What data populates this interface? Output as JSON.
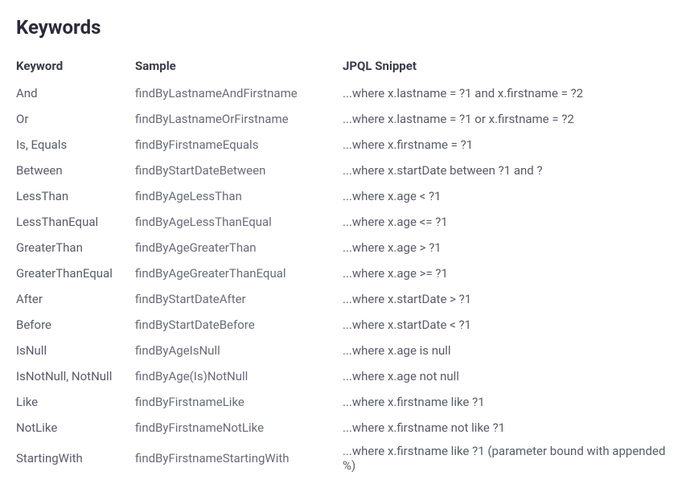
{
  "title": "Keywords",
  "headers": {
    "keyword": "Keyword",
    "sample": "Sample",
    "jpql": "JPQL Snippet"
  },
  "rows": [
    {
      "keyword": "And",
      "sample": "findByLastnameAndFirstname",
      "jpql": "...where x.lastname = ?1 and x.firstname = ?2"
    },
    {
      "keyword": "Or",
      "sample": "findByLastnameOrFirstname",
      "jpql": "...where x.lastname = ?1 or x.firstname = ?2"
    },
    {
      "keyword": "Is, Equals",
      "sample": "findByFirstnameEquals",
      "jpql": "...where x.firstname = ?1"
    },
    {
      "keyword": "Between",
      "sample": "findByStartDateBetween",
      "jpql": "...where x.startDate between ?1 and ?"
    },
    {
      "keyword": "LessThan",
      "sample": "findByAgeLessThan",
      "jpql": "...where x.age < ?1"
    },
    {
      "keyword": "LessThanEqual",
      "sample": "findByAgeLessThanEqual",
      "jpql": "...where x.age <= ?1"
    },
    {
      "keyword": "GreaterThan",
      "sample": "findByAgeGreaterThan",
      "jpql": "...where x.age > ?1"
    },
    {
      "keyword": "GreaterThanEqual",
      "sample": "findByAgeGreaterThanEqual",
      "jpql": "...where x.age >= ?1"
    },
    {
      "keyword": "After",
      "sample": "findByStartDateAfter",
      "jpql": "...where x.startDate > ?1"
    },
    {
      "keyword": "Before",
      "sample": "findByStartDateBefore",
      "jpql": "...where x.startDate < ?1"
    },
    {
      "keyword": "IsNull",
      "sample": "findByAgeIsNull",
      "jpql": "...where x.age is null"
    },
    {
      "keyword": "IsNotNull, NotNull",
      "sample": "findByAge(Is)NotNull",
      "jpql": "...where x.age not null"
    },
    {
      "keyword": "Like",
      "sample": "findByFirstnameLike",
      "jpql": "...where x.firstname like ?1"
    },
    {
      "keyword": "NotLike",
      "sample": "findByFirstnameNotLike",
      "jpql": "...where x.firstname not like ?1"
    },
    {
      "keyword": "StartingWith",
      "sample": "findByFirstnameStartingWith",
      "jpql": "...where x.firstname like ?1 (parameter bound with appended %)"
    }
  ]
}
